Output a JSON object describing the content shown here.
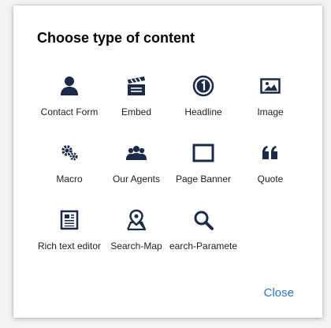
{
  "dialog": {
    "title": "Choose type of content",
    "close_label": "Close",
    "icon_color": "#1b2a47",
    "link_color": "#2a78c8"
  },
  "items": [
    {
      "label": "Contact Form",
      "icon": "person-icon"
    },
    {
      "label": "Embed",
      "icon": "clapperboard-icon"
    },
    {
      "label": "Headline",
      "icon": "number-one-icon"
    },
    {
      "label": "Image",
      "icon": "image-icon"
    },
    {
      "label": "Macro",
      "icon": "gears-icon"
    },
    {
      "label": "Our Agents",
      "icon": "group-icon"
    },
    {
      "label": "Page Banner",
      "icon": "banner-frame-icon"
    },
    {
      "label": "Quote",
      "icon": "quote-icon"
    },
    {
      "label": "Rich text editor",
      "icon": "document-icon"
    },
    {
      "label": "Search-Map",
      "icon": "map-pin-icon"
    },
    {
      "label": "earch-Paramete",
      "icon": "magnifier-icon"
    }
  ]
}
